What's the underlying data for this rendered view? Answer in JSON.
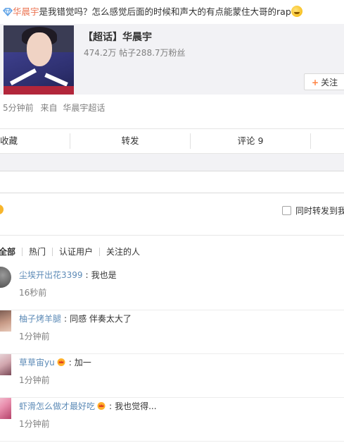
{
  "post": {
    "author": "华晨宇",
    "text": "是我错觉吗？怎么感觉后面的时候和声大的有点能蒙住大哥的rap"
  },
  "topic_card": {
    "title": "【超话】华晨宇",
    "stats": "474.2万 帖子288.7万粉丝",
    "follow_label": "关注"
  },
  "meta": {
    "time": "5分钟前",
    "from": "来自",
    "source": "华晨宇超话"
  },
  "actions": {
    "favorite": "收藏",
    "repost": "转发",
    "comment": "评论 9"
  },
  "reply_area": {
    "forward_label": "同时转发到我"
  },
  "filters": {
    "items": [
      "全部",
      "热门",
      "认证用户",
      "关注的人"
    ]
  },
  "comments": [
    {
      "user": "尘埃开出花3399",
      "text": "我也是",
      "time": "16秒前",
      "badge": false
    },
    {
      "user": "柚子烤羊腿",
      "text": "同感 伴奏太大了",
      "time": "1分钟前",
      "badge": false
    },
    {
      "user": "草草宙yu",
      "text": "加一",
      "time": "1分钟前",
      "badge": true
    },
    {
      "user": "虾滑怎么做才最好吃",
      "text": "我也觉得...",
      "time": "1分钟前",
      "badge": true
    }
  ],
  "colors": {
    "author": "#eb7350",
    "username": "#5d8bb7",
    "muted": "#808080",
    "accent": "#ff8140"
  }
}
